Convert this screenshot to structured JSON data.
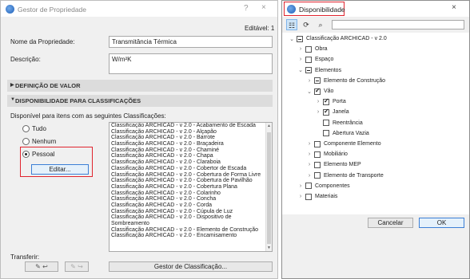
{
  "left_window": {
    "title": "Gestor de Propriedade",
    "help": "?",
    "close": "×",
    "editable_label": "Editável: 1",
    "name_label": "Nome da Propriedade:",
    "name_value": "Transmitância Térmica",
    "desc_label": "Descrição:",
    "desc_value": "W/m²K",
    "section1": "DEFINIÇÃO DE VALOR",
    "section2": "DISPONIBILIDADE PARA CLASSIFICAÇÕES",
    "available_label": "Disponível para itens com as seguintes Classificações:",
    "radio_all": "Tudo",
    "radio_none": "Nenhum",
    "radio_custom": "Pessoal",
    "edit_button": "Editar...",
    "transfer_label": "Transferir:",
    "manager_button": "Gestor de Classificação...",
    "class_list": [
      "Classificação ARCHICAD - v 2.0 - Acabamento de Escada",
      "Classificação ARCHICAD - v 2.0 - Alçapão",
      "Classificação ARCHICAD - v 2.0 - Barrote",
      "Classificação ARCHICAD - v 2.0 - Braçadeira",
      "Classificação ARCHICAD - v 2.0 - Chaminé",
      "Classificação ARCHICAD - v 2.0 - Chapa",
      "Classificação ARCHICAD - v 2.0 - Claraboia",
      "Classificação ARCHICAD - v 2.0 - Cobertor de Escada",
      "Classificação ARCHICAD - v 2.0 - Cobertura de Forma Livre",
      "Classificação ARCHICAD - v 2.0 - Cobertura de Pavilhão",
      "Classificação ARCHICAD - v 2.0 - Cobertura Plana",
      "Classificação ARCHICAD - v 2.0 - Colarinho",
      "Classificação ARCHICAD - v 2.0 - Concha",
      "Classificação ARCHICAD - v 2.0 - Corda",
      "Classificação ARCHICAD - v 2.0 - Cúpula de Luz",
      "Classificação ARCHICAD - v 2.0 - Dispositivo de",
      "Sombreamento",
      "Classificação ARCHICAD - v 2.0 - Elemento de Construção",
      "Classificação ARCHICAD - v 2.0 - Encamisamento"
    ]
  },
  "right_window": {
    "title": "Disponibilidade",
    "close": "×",
    "search_placeholder": "",
    "cancel_button": "Cancelar",
    "ok_button": "OK",
    "tree": [
      {
        "label": "Classificação ARCHICAD - v 2.0",
        "state": "partial",
        "chev": "v",
        "level": 0
      },
      {
        "label": "Obra",
        "state": "none",
        "chev": ">",
        "level": 1
      },
      {
        "label": "Espaço",
        "state": "none",
        "chev": ">",
        "level": 1
      },
      {
        "label": "Elementos",
        "state": "partial",
        "chev": "v",
        "level": 1
      },
      {
        "label": "Elemento de Construção",
        "state": "partial",
        "chev": ">",
        "level": 2
      },
      {
        "label": "Vão",
        "state": "checked",
        "chev": "v",
        "level": 2
      },
      {
        "label": "Porta",
        "state": "checked",
        "chev": ">",
        "level": 3
      },
      {
        "label": "Janela",
        "state": "checked",
        "chev": ">",
        "level": 3
      },
      {
        "label": "Reentrância",
        "state": "none",
        "chev": "",
        "level": 3
      },
      {
        "label": "Abertura Vazia",
        "state": "none",
        "chev": "",
        "level": 3
      },
      {
        "label": "Componente Elemento",
        "state": "none",
        "chev": ">",
        "level": 2
      },
      {
        "label": "Mobiliário",
        "state": "none",
        "chev": ">",
        "level": 2
      },
      {
        "label": "Elemento MEP",
        "state": "none",
        "chev": ">",
        "level": 2
      },
      {
        "label": "Elemento de Transporte",
        "state": "none",
        "chev": ">",
        "level": 2
      },
      {
        "label": "Componentes",
        "state": "none",
        "chev": ">",
        "level": 1
      },
      {
        "label": "Materiais",
        "state": "none",
        "chev": ">",
        "level": 1
      }
    ]
  }
}
